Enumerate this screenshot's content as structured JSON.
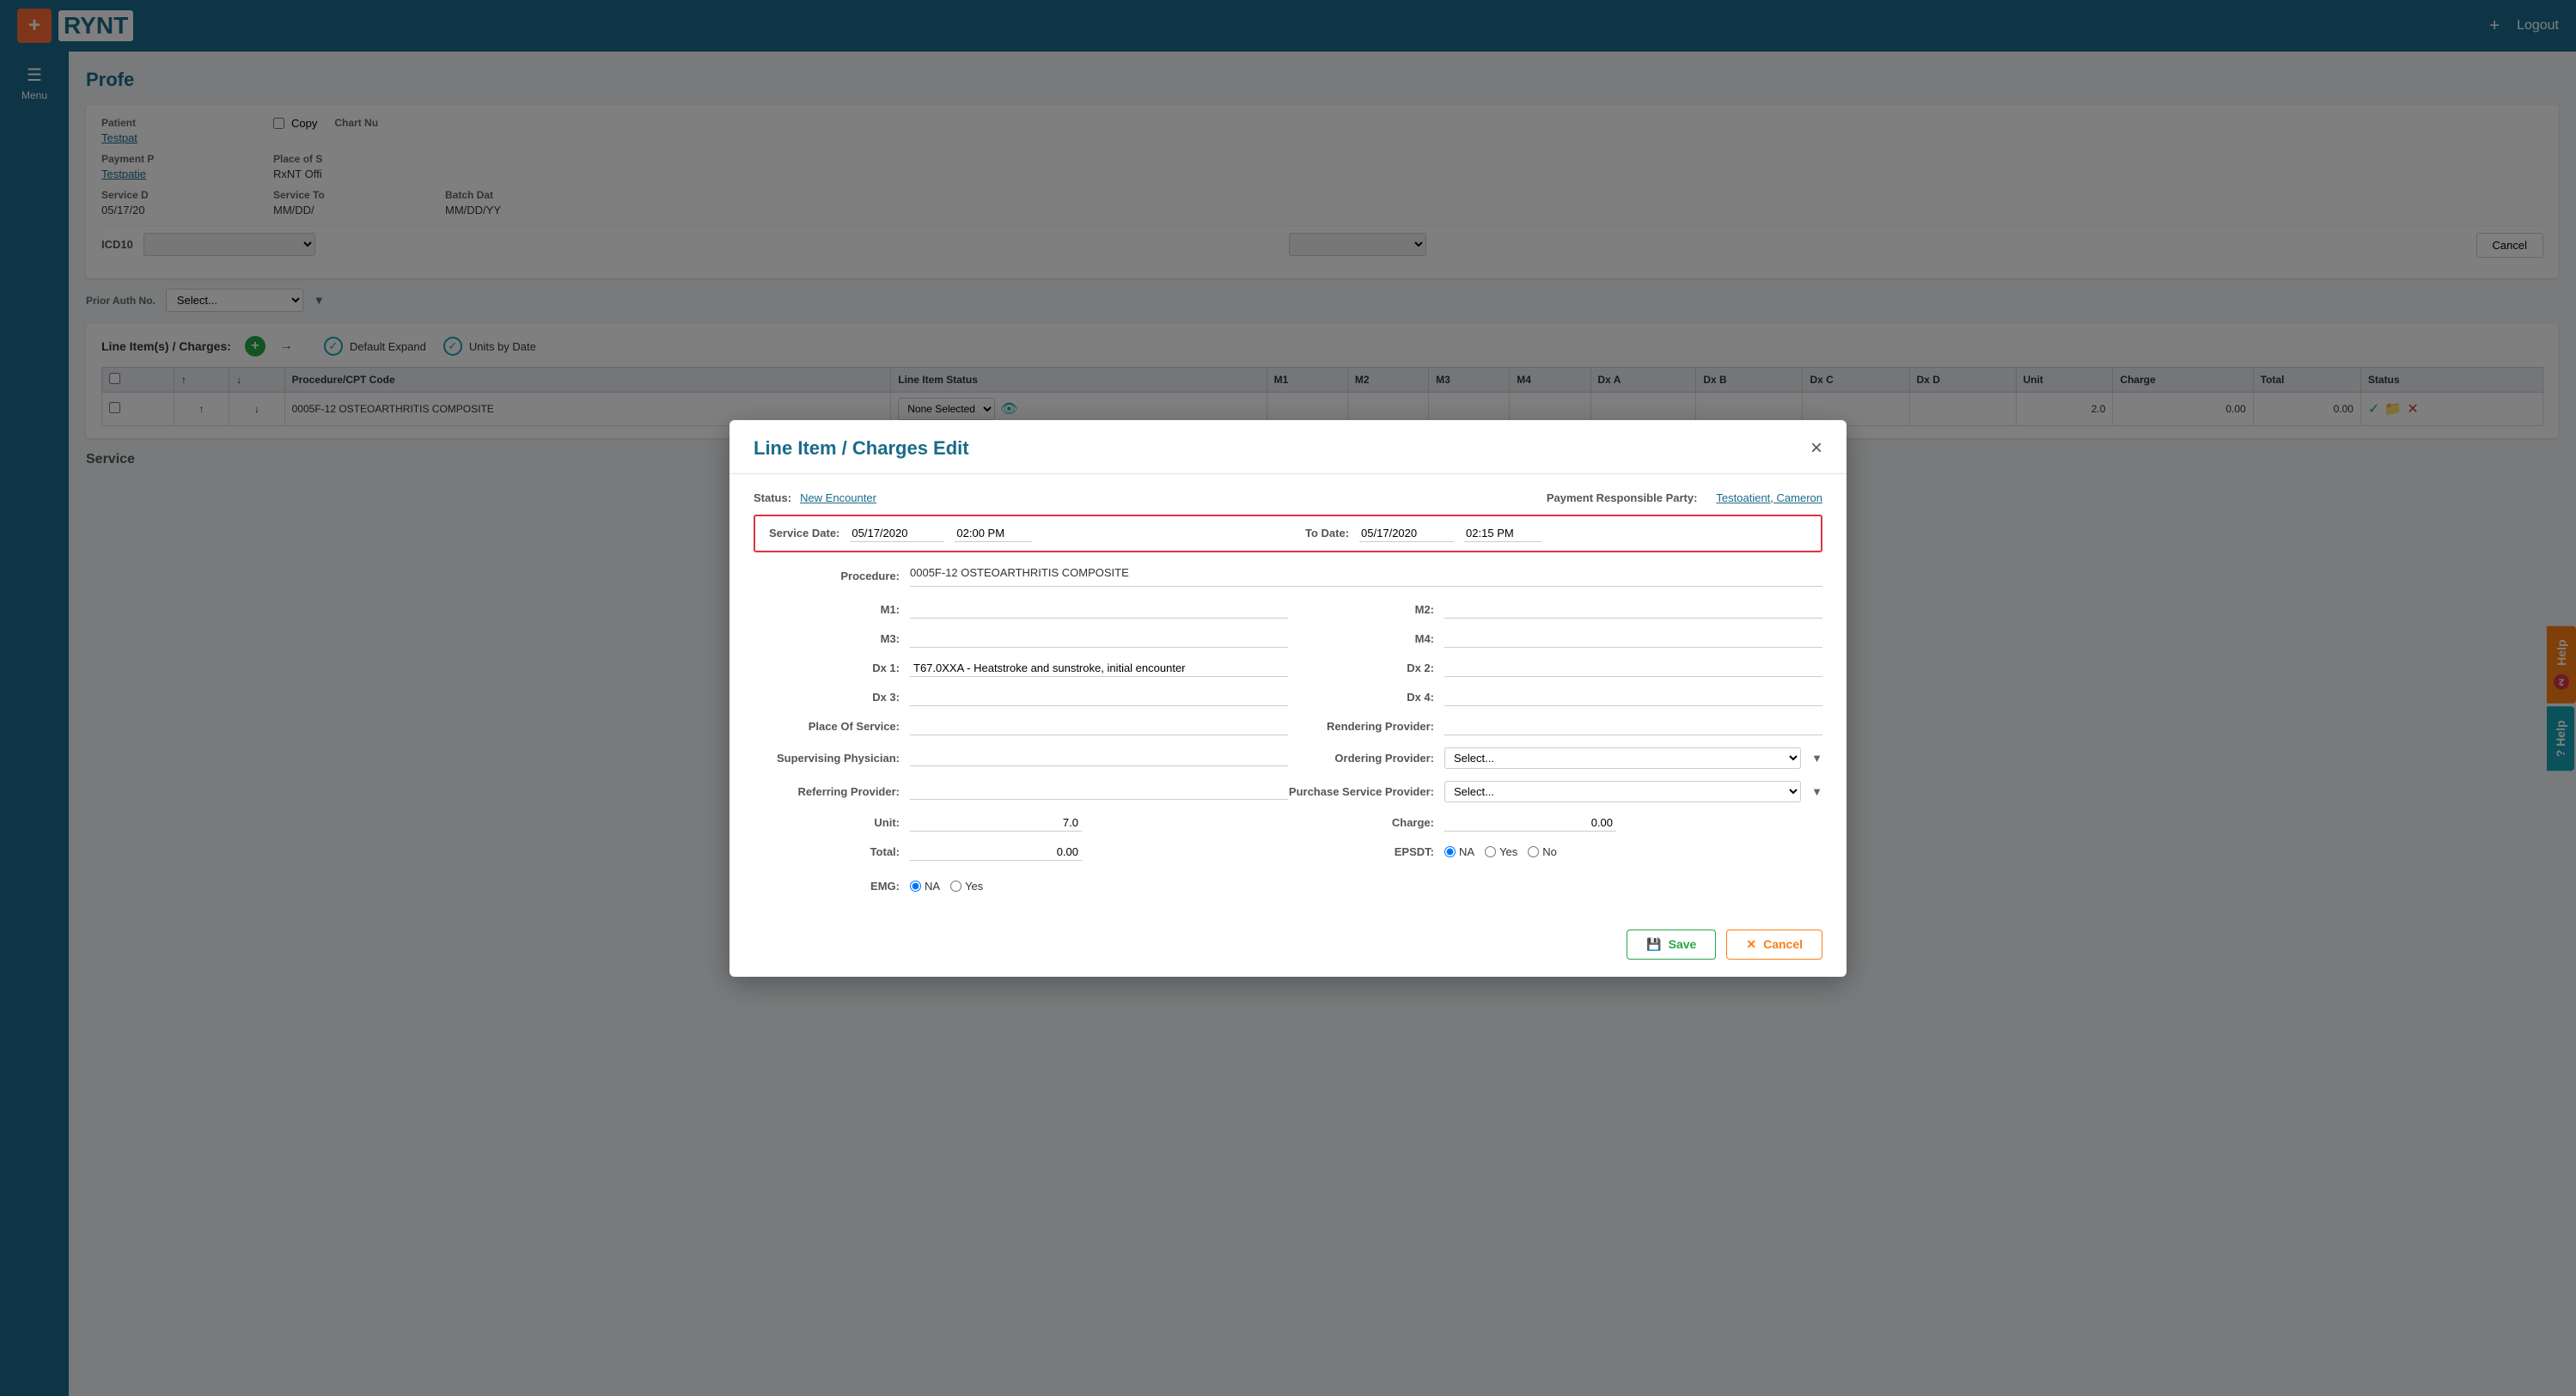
{
  "app": {
    "title": "RYNT",
    "top_nav": {
      "logout_label": "Logout"
    },
    "sidebar": {
      "menu_label": "Menu"
    }
  },
  "background": {
    "page_title": "Profe",
    "patient_section": {
      "label": "Patient",
      "value": "Testpat"
    },
    "copy_label": "Copy",
    "chart_num_label": "Chart Nu",
    "payment_label": "Payment P",
    "payment_value": "Testpatie",
    "place_label": "Place of S",
    "place_value": "RxNT Offi",
    "service_d_label": "Service D",
    "service_d_value": "05/17/20",
    "service_to_label": "Service To",
    "service_to_value": "MM/DD/",
    "batch_label": "Batch Dat",
    "batch_value": "MM/DD/YY",
    "prior_auth_label": "Prior Auth No.",
    "prior_auth_select": "Select...",
    "line_items_label": "Line Item(s) / Charges:",
    "default_expand_label": "Default Expand",
    "units_by_date_label": "Units by Date",
    "table": {
      "headers": [
        "",
        "",
        "",
        "Procedure/CPT Code",
        "Line Item Status",
        "M1",
        "M2",
        "M3",
        "M4",
        "Dx A",
        "Dx B",
        "Dx C",
        "Dx D",
        "Unit",
        "Charge",
        "Total",
        "Status"
      ],
      "row": {
        "procedure": "0005F-12 OSTEOARTHRITIS COMPOSITE",
        "status": "None Selected",
        "m1": "",
        "m2": "",
        "m3": "",
        "m4": "",
        "dxa": "",
        "dxb": "",
        "dxc": "",
        "dxd": "",
        "unit": "2.0",
        "charge": "0.00",
        "total": "0.00"
      }
    },
    "icd10_label": "ICD10",
    "cancel_btn": "Cancel",
    "service_label": "Service"
  },
  "modal": {
    "title": "Line Item / Charges Edit",
    "close_icon": "×",
    "status_label": "Status:",
    "status_value": "New Encounter",
    "payment_party_label": "Payment Responsible Party:",
    "payment_party_value": "Testoatient, Cameron",
    "service_date_label": "Service Date:",
    "service_date_value": "05/17/2020",
    "service_date_time": "02:00 PM",
    "to_date_label": "To Date:",
    "to_date_value": "05/17/2020",
    "to_date_time": "02:15 PM",
    "procedure_label": "Procedure:",
    "procedure_value": "0005F-12 OSTEOARTHRITIS COMPOSITE",
    "m1_label": "M1:",
    "m1_value": "",
    "m2_label": "M2:",
    "m2_value": "",
    "m3_label": "M3:",
    "m3_value": "",
    "m4_label": "M4:",
    "m4_value": "",
    "dx1_label": "Dx 1:",
    "dx1_value": "T67.0XXA - Heatstroke and sunstroke, initial encounter",
    "dx2_label": "Dx 2:",
    "dx2_value": "",
    "dx3_label": "Dx 3:",
    "dx3_value": "",
    "dx4_label": "Dx 4:",
    "dx4_value": "",
    "place_of_service_label": "Place Of Service:",
    "place_of_service_value": "",
    "rendering_provider_label": "Rendering Provider:",
    "rendering_provider_value": "",
    "supervising_physician_label": "Supervising Physician:",
    "supervising_physician_value": "",
    "ordering_provider_label": "Ordering Provider:",
    "ordering_provider_select": "Select...",
    "referring_provider_label": "Referring Provider:",
    "referring_provider_value": "",
    "purchase_service_label": "Purchase Service Provider:",
    "purchase_service_select": "Select...",
    "unit_label": "Unit:",
    "unit_value": "7.0",
    "charge_label": "Charge:",
    "charge_value": "0.00",
    "total_label": "Total:",
    "total_value": "0.00",
    "epsdt_label": "EPSDT:",
    "epsdt_na": "NA",
    "epsdt_yes": "Yes",
    "epsdt_no": "No",
    "emg_label": "EMG:",
    "emg_na": "NA",
    "emg_yes": "Yes",
    "save_label": "Save",
    "cancel_label": "Cancel"
  },
  "help": {
    "badge": "2",
    "help_label": "Help",
    "help2_label": "Help"
  }
}
